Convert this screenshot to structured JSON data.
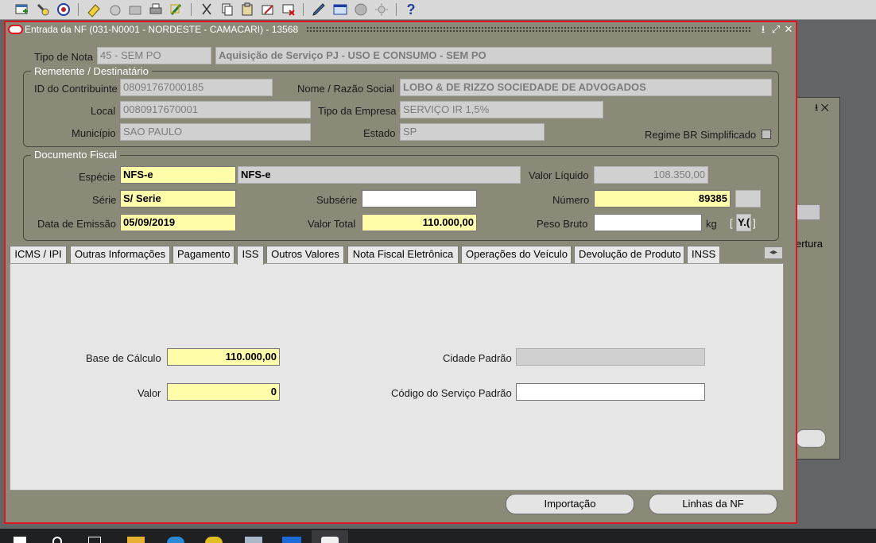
{
  "toolbar": {
    "icons": [
      "new-record-icon",
      "search-flashlight-icon",
      "navigator-icon",
      "save-icon",
      "clear-icon",
      "folder-icon",
      "print-icon",
      "attach-icon",
      "cut-icon",
      "copy-icon",
      "paste-icon",
      "edit-icon",
      "delete-record-icon",
      "pen-icon",
      "window-icon",
      "globe-icon",
      "sun-icon",
      "help-icon"
    ],
    "help_label": "?"
  },
  "background_window": {
    "controls": "⭳ ✕",
    "fragment_text": "ertura"
  },
  "dialog": {
    "title": "Entrada da NF (031-N0001 - NORDESTE - CAMACARI) - 13568",
    "controls": {
      "minimize": "⭳",
      "maximize": "⤢",
      "close": "✕"
    }
  },
  "header": {
    "tipo_nota_label": "Tipo de Nota",
    "tipo_nota_code": "45 - SEM PO",
    "tipo_nota_desc": "Aquisição de Serviço PJ - USO E CONSUMO - SEM PO"
  },
  "remetente": {
    "legend": "Remetente / Destinatário",
    "id_label": "ID do Contribuinte",
    "id_value": "08091767000185",
    "nome_label": "Nome / Razão Social",
    "nome_value": "LOBO & DE RIZZO SOCIEDADE DE ADVOGADOS",
    "local_label": "Local",
    "local_value": "0080917670001",
    "tipo_empresa_label": "Tipo da Empresa",
    "tipo_empresa_value": "SERVIÇO IR 1,5%",
    "municipio_label": "Município",
    "municipio_value": "SAO PAULO",
    "estado_label": "Estado",
    "estado_value": "SP",
    "regime_label": "Regime BR Simplificado",
    "regime_checked": false
  },
  "documento": {
    "legend": "Documento Fiscal",
    "especie_label": "Espécie",
    "especie_value": "NFS-e",
    "especie_desc": "NFS-e",
    "valor_liquido_label": "Valor Líquido",
    "valor_liquido_value": "108.350,00",
    "serie_label": "Série",
    "serie_value": "S/ Serie",
    "subserie_label": "Subsérie",
    "subserie_value": "",
    "numero_label": "Número",
    "numero_value": "89385",
    "data_label": "Data de Emissão",
    "data_value": "05/09/2019",
    "valor_total_label": "Valor Total",
    "valor_total_value": "110.000,00",
    "peso_label": "Peso Bruto",
    "peso_value": "",
    "kg_label": "kg",
    "flag_open": "[",
    "flag_value": "Y.(",
    "flag_close": "]"
  },
  "tabs": [
    {
      "label": "ICMS / IPI"
    },
    {
      "label": "Outras Informações"
    },
    {
      "label": "Pagamento"
    },
    {
      "label": "ISS",
      "active": true
    },
    {
      "label": "Outros Valores"
    },
    {
      "label": "Nota Fiscal Eletrônica"
    },
    {
      "label": "Operações do Veículo"
    },
    {
      "label": "Devolução de Produto"
    },
    {
      "label": "INSS"
    }
  ],
  "iss": {
    "base_label": "Base de Cálculo",
    "base_value": "110.000,00",
    "valor_label": "Valor",
    "valor_value": "0",
    "cidade_label": "Cidade Padrão",
    "cidade_value": "",
    "codigo_label": "Código do Serviço Padrão",
    "codigo_value": ""
  },
  "buttons": {
    "importacao": "Importação",
    "linhas": "Linhas da NF"
  },
  "taskbar": {
    "icons": [
      "windows-start-icon",
      "search-icon",
      "task-view-icon",
      "file-explorer-icon",
      "internet-explorer-icon",
      "chrome-icon",
      "cloud-app-icon",
      "office-app-icon",
      "oracle-app-icon"
    ]
  }
}
